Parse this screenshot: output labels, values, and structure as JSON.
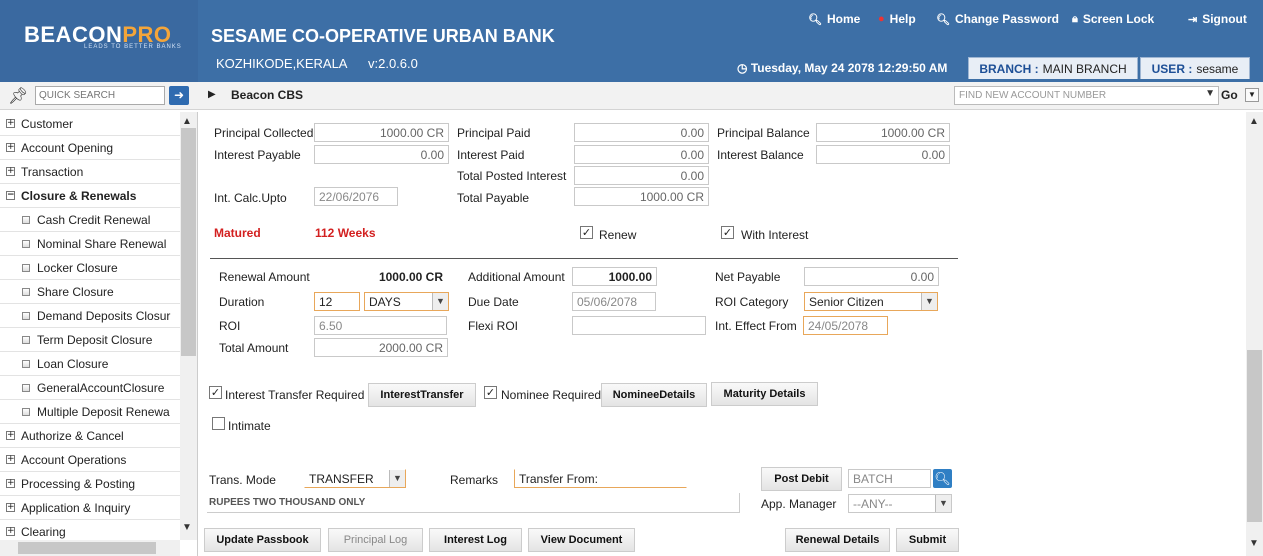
{
  "header": {
    "logo_main": "BEACON",
    "logo_pro": "PRO",
    "logo_tag": "LEADS TO BETTER BANKS",
    "bank_name": "SESAME CO-OPERATIVE URBAN BANK",
    "location": "KOZHIKODE,KERALA",
    "version": "v:2.0.6.0",
    "links": {
      "home": "Home",
      "help": "Help",
      "change_password": "Change Password",
      "screen_lock": "Screen Lock",
      "signout": "Signout"
    },
    "datetime": "Tuesday, May 24 2078 12:29:50 AM",
    "branch_label": "BRANCH :",
    "branch_value": "MAIN BRANCH",
    "user_label": "USER :",
    "user_value": "sesame"
  },
  "toolbar": {
    "quick_search_placeholder": "QUICK SEARCH",
    "breadcrumb": "Beacon CBS",
    "account_search_placeholder": "FIND NEW ACCOUNT NUMBER",
    "go_label": "Go"
  },
  "sidebar": {
    "items": [
      {
        "label": "Customer",
        "toggle": "+"
      },
      {
        "label": "Account Opening",
        "toggle": "+"
      },
      {
        "label": "Transaction",
        "toggle": "+"
      },
      {
        "label": "Closure & Renewals",
        "toggle": "−"
      },
      {
        "label": "Cash Credit Renewal"
      },
      {
        "label": "Nominal Share Renewal"
      },
      {
        "label": "Locker Closure"
      },
      {
        "label": "Share Closure"
      },
      {
        "label": "Demand Deposits Closur"
      },
      {
        "label": "Term Deposit Closure"
      },
      {
        "label": "Loan Closure"
      },
      {
        "label": "GeneralAccountClosure"
      },
      {
        "label": "Multiple Deposit Renewa"
      },
      {
        "label": "Authorize & Cancel",
        "toggle": "+"
      },
      {
        "label": "Account Operations",
        "toggle": "+"
      },
      {
        "label": "Processing & Posting",
        "toggle": "+"
      },
      {
        "label": "Application & Inquiry",
        "toggle": "+"
      },
      {
        "label": "Clearing",
        "toggle": "+"
      }
    ]
  },
  "summary": {
    "principal_collected_label": "Principal Collected",
    "principal_collected": "1000.00 CR",
    "interest_payable_label": "Interest Payable",
    "interest_payable": "0.00",
    "int_calc_upto_label": "Int. Calc.Upto",
    "int_calc_upto": "22/06/2076",
    "principal_paid_label": "Principal Paid",
    "principal_paid": "0.00",
    "interest_paid_label": "Interest Paid",
    "interest_paid": "0.00",
    "total_posted_interest_label": "Total Posted Interest",
    "total_posted_interest": "0.00",
    "total_payable_label": "Total Payable",
    "total_payable": "1000.00 CR",
    "principal_balance_label": "Principal Balance",
    "principal_balance": "1000.00 CR",
    "interest_balance_label": "Interest Balance",
    "interest_balance": "0.00",
    "status": "Matured",
    "weeks": "112 Weeks",
    "renew_label": "Renew",
    "with_interest_label": "With Interest"
  },
  "renewal": {
    "renewal_amount_label": "Renewal Amount",
    "renewal_amount": "1000.00 CR",
    "duration_label": "Duration",
    "duration_value": "12",
    "duration_unit": "DAYS",
    "roi_label": "ROI",
    "roi_value": "6.50",
    "total_amount_label": "Total Amount",
    "total_amount": "2000.00 CR",
    "additional_amount_label": "Additional Amount",
    "additional_amount": "1000.00",
    "due_date_label": "Due Date",
    "due_date": "05/06/2078",
    "flexi_roi_label": "Flexi ROI",
    "flexi_roi": "",
    "net_payable_label": "Net Payable",
    "net_payable": "0.00",
    "roi_category_label": "ROI Category",
    "roi_category": "Senior Citizen",
    "int_effect_from_label": "Int. Effect From",
    "int_effect_from": "24/05/2078"
  },
  "options": {
    "interest_transfer_label": "Interest Transfer Required",
    "interest_transfer_button": "InterestTransfer",
    "nominee_required_label": "Nominee Required",
    "nominee_details_button": "NomineeDetails",
    "maturity_details_button": "Maturity Details",
    "intimate_label": "Intimate"
  },
  "transaction": {
    "trans_mode_label": "Trans. Mode",
    "trans_mode": "TRANSFER",
    "remarks_label": "Remarks",
    "remarks": "Transfer From:",
    "amount_words": "RUPEES TWO THOUSAND ONLY",
    "post_debit_button": "Post Debit",
    "batch_placeholder": "BATCH",
    "app_manager_label": "App. Manager",
    "app_manager": "--ANY--"
  },
  "footer_buttons": {
    "update_passbook": "Update Passbook",
    "principal_log": "Principal Log",
    "interest_log": "Interest Log",
    "view_document": "View Document",
    "renewal_details": "Renewal Details",
    "submit": "Submit"
  },
  "colors": {
    "header_bg": "#3d6fa6",
    "accent_orange": "#f3a53a",
    "matured_red": "#d32020"
  }
}
